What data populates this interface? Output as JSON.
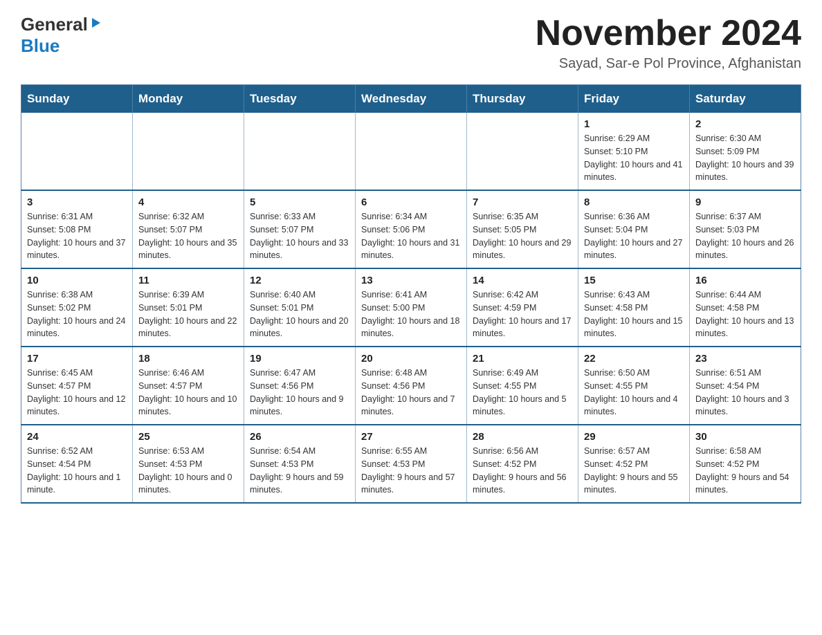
{
  "header": {
    "logo": {
      "general": "General",
      "blue": "Blue"
    },
    "title": "November 2024",
    "subtitle": "Sayad, Sar-e Pol Province, Afghanistan"
  },
  "calendar": {
    "days_of_week": [
      "Sunday",
      "Monday",
      "Tuesday",
      "Wednesday",
      "Thursday",
      "Friday",
      "Saturday"
    ],
    "weeks": [
      [
        {
          "day": "",
          "info": ""
        },
        {
          "day": "",
          "info": ""
        },
        {
          "day": "",
          "info": ""
        },
        {
          "day": "",
          "info": ""
        },
        {
          "day": "",
          "info": ""
        },
        {
          "day": "1",
          "info": "Sunrise: 6:29 AM\nSunset: 5:10 PM\nDaylight: 10 hours and 41 minutes."
        },
        {
          "day": "2",
          "info": "Sunrise: 6:30 AM\nSunset: 5:09 PM\nDaylight: 10 hours and 39 minutes."
        }
      ],
      [
        {
          "day": "3",
          "info": "Sunrise: 6:31 AM\nSunset: 5:08 PM\nDaylight: 10 hours and 37 minutes."
        },
        {
          "day": "4",
          "info": "Sunrise: 6:32 AM\nSunset: 5:07 PM\nDaylight: 10 hours and 35 minutes."
        },
        {
          "day": "5",
          "info": "Sunrise: 6:33 AM\nSunset: 5:07 PM\nDaylight: 10 hours and 33 minutes."
        },
        {
          "day": "6",
          "info": "Sunrise: 6:34 AM\nSunset: 5:06 PM\nDaylight: 10 hours and 31 minutes."
        },
        {
          "day": "7",
          "info": "Sunrise: 6:35 AM\nSunset: 5:05 PM\nDaylight: 10 hours and 29 minutes."
        },
        {
          "day": "8",
          "info": "Sunrise: 6:36 AM\nSunset: 5:04 PM\nDaylight: 10 hours and 27 minutes."
        },
        {
          "day": "9",
          "info": "Sunrise: 6:37 AM\nSunset: 5:03 PM\nDaylight: 10 hours and 26 minutes."
        }
      ],
      [
        {
          "day": "10",
          "info": "Sunrise: 6:38 AM\nSunset: 5:02 PM\nDaylight: 10 hours and 24 minutes."
        },
        {
          "day": "11",
          "info": "Sunrise: 6:39 AM\nSunset: 5:01 PM\nDaylight: 10 hours and 22 minutes."
        },
        {
          "day": "12",
          "info": "Sunrise: 6:40 AM\nSunset: 5:01 PM\nDaylight: 10 hours and 20 minutes."
        },
        {
          "day": "13",
          "info": "Sunrise: 6:41 AM\nSunset: 5:00 PM\nDaylight: 10 hours and 18 minutes."
        },
        {
          "day": "14",
          "info": "Sunrise: 6:42 AM\nSunset: 4:59 PM\nDaylight: 10 hours and 17 minutes."
        },
        {
          "day": "15",
          "info": "Sunrise: 6:43 AM\nSunset: 4:58 PM\nDaylight: 10 hours and 15 minutes."
        },
        {
          "day": "16",
          "info": "Sunrise: 6:44 AM\nSunset: 4:58 PM\nDaylight: 10 hours and 13 minutes."
        }
      ],
      [
        {
          "day": "17",
          "info": "Sunrise: 6:45 AM\nSunset: 4:57 PM\nDaylight: 10 hours and 12 minutes."
        },
        {
          "day": "18",
          "info": "Sunrise: 6:46 AM\nSunset: 4:57 PM\nDaylight: 10 hours and 10 minutes."
        },
        {
          "day": "19",
          "info": "Sunrise: 6:47 AM\nSunset: 4:56 PM\nDaylight: 10 hours and 9 minutes."
        },
        {
          "day": "20",
          "info": "Sunrise: 6:48 AM\nSunset: 4:56 PM\nDaylight: 10 hours and 7 minutes."
        },
        {
          "day": "21",
          "info": "Sunrise: 6:49 AM\nSunset: 4:55 PM\nDaylight: 10 hours and 5 minutes."
        },
        {
          "day": "22",
          "info": "Sunrise: 6:50 AM\nSunset: 4:55 PM\nDaylight: 10 hours and 4 minutes."
        },
        {
          "day": "23",
          "info": "Sunrise: 6:51 AM\nSunset: 4:54 PM\nDaylight: 10 hours and 3 minutes."
        }
      ],
      [
        {
          "day": "24",
          "info": "Sunrise: 6:52 AM\nSunset: 4:54 PM\nDaylight: 10 hours and 1 minute."
        },
        {
          "day": "25",
          "info": "Sunrise: 6:53 AM\nSunset: 4:53 PM\nDaylight: 10 hours and 0 minutes."
        },
        {
          "day": "26",
          "info": "Sunrise: 6:54 AM\nSunset: 4:53 PM\nDaylight: 9 hours and 59 minutes."
        },
        {
          "day": "27",
          "info": "Sunrise: 6:55 AM\nSunset: 4:53 PM\nDaylight: 9 hours and 57 minutes."
        },
        {
          "day": "28",
          "info": "Sunrise: 6:56 AM\nSunset: 4:52 PM\nDaylight: 9 hours and 56 minutes."
        },
        {
          "day": "29",
          "info": "Sunrise: 6:57 AM\nSunset: 4:52 PM\nDaylight: 9 hours and 55 minutes."
        },
        {
          "day": "30",
          "info": "Sunrise: 6:58 AM\nSunset: 4:52 PM\nDaylight: 9 hours and 54 minutes."
        }
      ]
    ]
  }
}
